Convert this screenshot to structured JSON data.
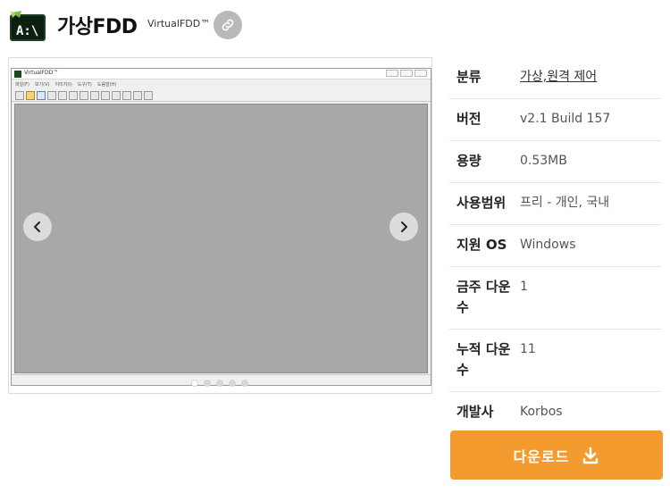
{
  "header": {
    "title": "가상FDD",
    "subtitle": "VirtualFDD™",
    "app_icon": "terminal-drive-icon",
    "link_icon": "link-icon"
  },
  "gallery": {
    "screenshot": {
      "window_title": "VirtualFDD™",
      "menus": [
        "파일(F)",
        "보기(V)",
        "이미지(I)",
        "도구(T)",
        "도움말(H)"
      ]
    },
    "dot_count": 5,
    "active_dot": 1
  },
  "info": {
    "rows": [
      {
        "label": "분류",
        "value": "가상,원격 제어"
      },
      {
        "label": "버전",
        "value": "v2.1 Build 157"
      },
      {
        "label": "용량",
        "value": "0.53MB"
      },
      {
        "label": "사용범위",
        "value": "프리 - 개인, 국내"
      },
      {
        "label": "지원 OS",
        "value": "Windows"
      },
      {
        "label": "금주 다운수",
        "value": "1"
      },
      {
        "label": "누적 다운수",
        "value": "11"
      },
      {
        "label": "개발사",
        "value": "Korbos"
      }
    ]
  },
  "download": {
    "label": "다운로드",
    "icon": "download-icon",
    "color": "#f39b2f"
  }
}
